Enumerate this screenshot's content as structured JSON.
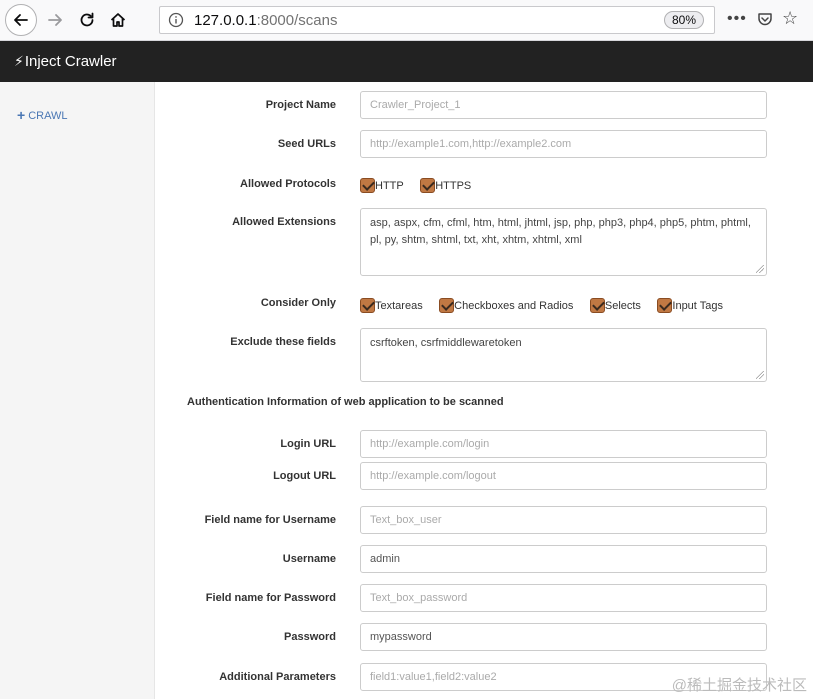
{
  "browser": {
    "url_host": "127.0.0.1",
    "url_rest": ":8000/scans",
    "zoom": "80%"
  },
  "app": {
    "brand": "Inject Crawler"
  },
  "sidebar": {
    "items": [
      {
        "label": "CRAWL"
      }
    ]
  },
  "form": {
    "project_name": {
      "label": "Project Name",
      "placeholder": "Crawler_Project_1"
    },
    "seed_urls": {
      "label": "Seed URLs",
      "placeholder": "http://example1.com,http://example2.com"
    },
    "allowed_protocols": {
      "label": "Allowed Protocols",
      "options": [
        "HTTP",
        "HTTPS"
      ]
    },
    "allowed_extensions": {
      "label": "Allowed Extensions",
      "value": "asp, aspx, cfm, cfml, htm, html, jhtml, jsp, php, php3, php4, php5, phtm, phtml, pl, py, shtm, shtml, txt, xht, xhtm, xhtml, xml"
    },
    "consider_only": {
      "label": "Consider Only",
      "options": [
        "Textareas",
        "Checkboxes and Radios",
        "Selects",
        "Input Tags"
      ]
    },
    "exclude_fields": {
      "label": "Exclude these fields",
      "value": "csrftoken, csrfmiddlewaretoken"
    },
    "auth_heading": "Authentication Information of web application to be scanned",
    "login_url": {
      "label": "Login URL",
      "placeholder": "http://example.com/login"
    },
    "logout_url": {
      "label": "Logout URL",
      "placeholder": "http://example.com/logout"
    },
    "username_field": {
      "label": "Field name for Username",
      "placeholder": "Text_box_user"
    },
    "username": {
      "label": "Username",
      "value": "admin"
    },
    "password_field": {
      "label": "Field name for Password",
      "placeholder": "Text_box_password"
    },
    "password": {
      "label": "Password",
      "value": "mypassword"
    },
    "additional_params": {
      "label": "Additional Parameters",
      "placeholder": "field1:value1,field2:value2"
    }
  },
  "watermark": "@稀土掘金技术社区"
}
